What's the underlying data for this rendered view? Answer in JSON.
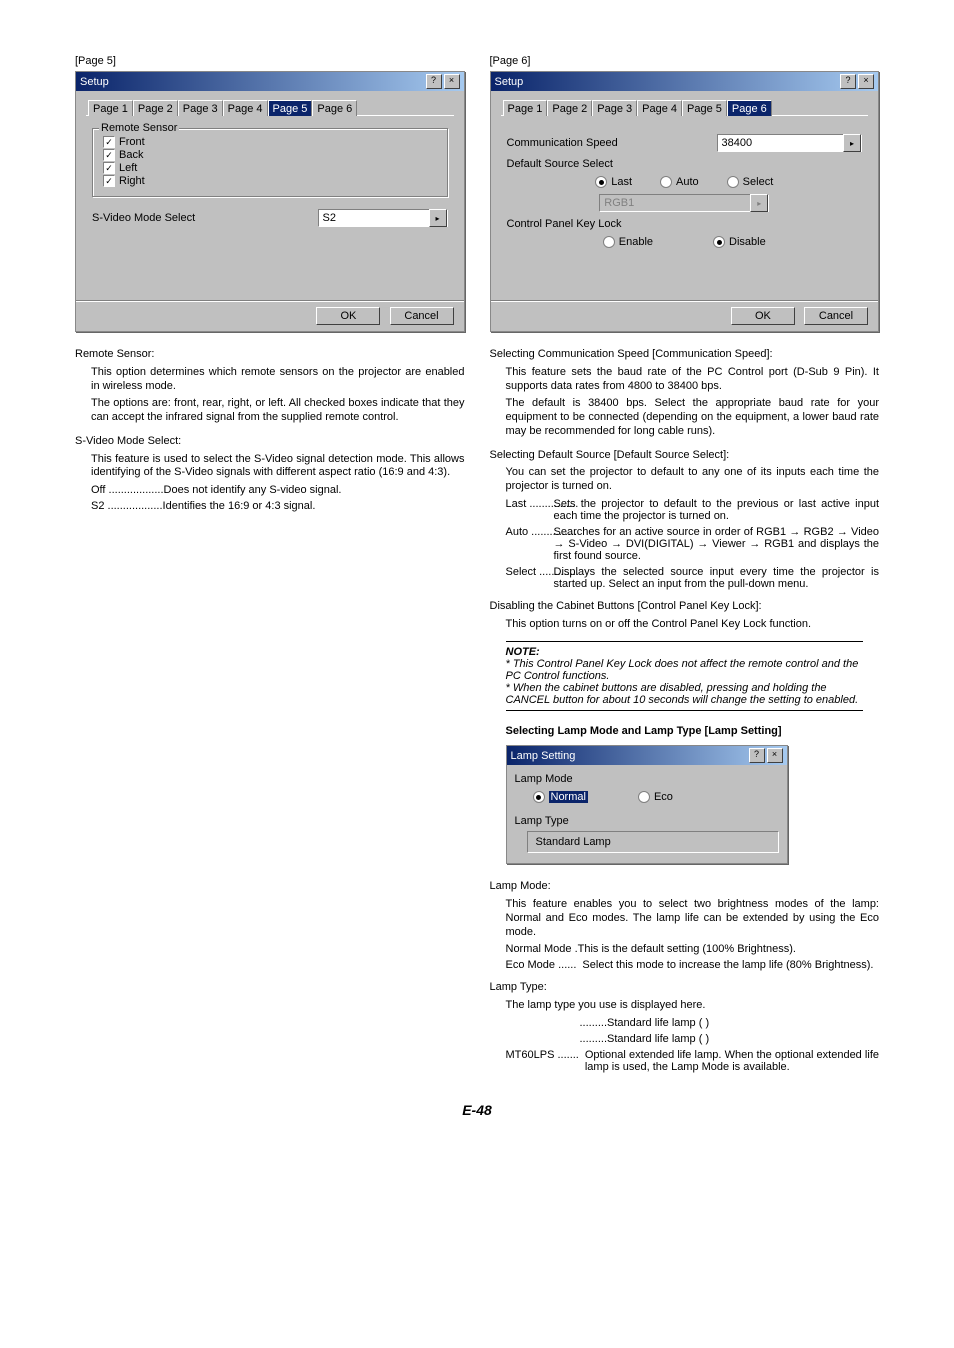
{
  "left": {
    "page_tag": "[Page 5]",
    "dlg": {
      "title": "Setup",
      "tabs": [
        "Page 1",
        "Page 2",
        "Page 3",
        "Page 4",
        "Page 5",
        "Page 6"
      ],
      "active_tab": "Page 5",
      "group_legend": "Remote Sensor",
      "checks": [
        "Front",
        "Back",
        "Left",
        "Right"
      ],
      "svideo_label": "S-Video Mode Select",
      "svideo_value": "S2",
      "ok": "OK",
      "cancel": "Cancel"
    },
    "remote_title": "Remote Sensor:",
    "remote_p1": "This option determines which remote sensors on the projector are enabled in wireless mode.",
    "remote_p2": "The options are: front, rear, right, or left. All checked boxes indicate that they can accept the infrared signal from the supplied remote control.",
    "sv_title": "S-Video Mode Select:",
    "sv_p1": "This feature is used to select the S-Video signal detection mode. This allows identifying of the S-Video signals with different aspect ratio (16:9 and 4:3).",
    "sv_off_term": "Off ..................",
    "sv_off_desc": "Does not identify any S-video signal.",
    "sv_s2_term": "S2 ..................",
    "sv_s2_desc": "Identifies the 16:9 or 4:3 signal."
  },
  "right": {
    "page_tag": "[Page 6]",
    "dlg": {
      "title": "Setup",
      "tabs": [
        "Page 1",
        "Page 2",
        "Page 3",
        "Page 4",
        "Page 5",
        "Page 6"
      ],
      "active_tab": "Page 6",
      "comm_label": "Communication Speed",
      "comm_value": "38400",
      "default_label": "Default Source Select",
      "radios": {
        "last": "Last",
        "auto": "Auto",
        "select": "Select"
      },
      "default_combo": "RGB1",
      "lock_label": "Control Panel Key Lock",
      "lock_enable": "Enable",
      "lock_disable": "Disable",
      "ok": "OK",
      "cancel": "Cancel"
    },
    "comm_title": "Selecting Communication Speed [Communication Speed]:",
    "comm_p1": "This feature sets the baud rate of the PC Control port (D-Sub 9 Pin). It supports data rates from 4800 to 38400 bps.",
    "comm_p2": "The default is 38400 bps. Select the appropriate baud rate for your equipment to be connected (depending on the equipment, a lower baud rate may be recommended for long cable runs).",
    "def_title": "Selecting Default Source [Default Source Select]:",
    "def_p1": "You can set the projector to default to any one of its inputs each time the projector is turned on.",
    "defs": [
      {
        "term": "Last ................",
        "desc": "Sets the projector to default to the previous or last active input each time the projector is turned on."
      },
      {
        "term": "Auto ...............",
        "desc": "Searches for an active source in order of RGB1 → RGB2 → Video → S-Video → DVI(DIGITAL) → Viewer → RGB1 and displays the first found source."
      },
      {
        "term": "Select .............",
        "desc": "Displays the selected source input every time the projector is started up. Select an input from the pull-down menu."
      }
    ],
    "lock_title": "Disabling the Cabinet Buttons [Control Panel Key Lock]:",
    "lock_p1": "This option turns on or off the Control Panel Key Lock function.",
    "note_title": "NOTE:",
    "note1": "* This Control Panel Key Lock does not affect the remote control and the PC Control functions.",
    "note2": "* When the cabinet buttons are disabled, pressing and holding the CANCEL button for about 10 seconds will change the setting to enabled.",
    "lamp_heading": "Selecting Lamp Mode and Lamp Type [Lamp Setting]",
    "lamp_dlg": {
      "title": "Lamp Setting",
      "mode_label": "Lamp Mode",
      "normal": "Normal",
      "eco": "Eco",
      "type_label": "Lamp Type",
      "type_value": "Standard Lamp"
    },
    "lm_title": "Lamp Mode:",
    "lm_p1": "This feature enables you to select two brightness modes of the lamp: Normal and Eco modes. The lamp life can be extended by using the Eco mode.",
    "lm_normal_term": "Normal Mode .",
    "lm_normal_desc": "This is the default setting (100% Brightness).",
    "lm_eco_term": "Eco Mode ......",
    "lm_eco_desc": "Select this mode to increase the lamp life (80% Brightness).",
    "lt_title": "Lamp Type:",
    "lt_p1": "The lamp type you use is displayed here.",
    "lt_row1_term": ".........",
    "lt_row1_desc": "Standard life lamp (          )",
    "lt_row2_term": ".........",
    "lt_row2_desc": "Standard life lamp (          )",
    "lt_row3_term": "MT60LPS .......",
    "lt_row3_desc": "Optional extended life lamp. When the optional extended life lamp is used, the Lamp Mode is available."
  },
  "page_num": "E-48"
}
